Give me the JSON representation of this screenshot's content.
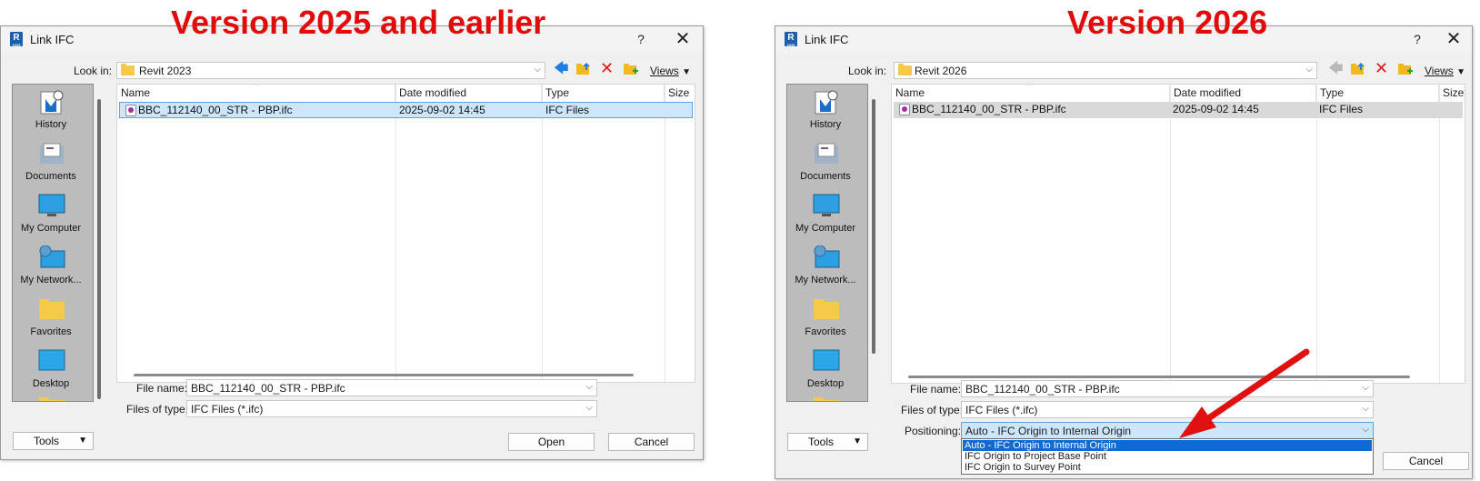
{
  "headings": {
    "left": "Version 2025 and earlier",
    "right": "Version 2026"
  },
  "colors": {
    "heading": "#e20a0a",
    "selection_blue": "#cde6fb",
    "dropdown_highlight": "#0f6ad6",
    "arrow": "#e01010"
  },
  "left_dialog": {
    "title": "Link IFC",
    "help": "?",
    "close": "✕",
    "look_in_label": "Look in:",
    "look_in_value": "Revit 2023",
    "views_label": "Views",
    "sidebar": [
      {
        "label": "History",
        "icon": "history-icon"
      },
      {
        "label": "Documents",
        "icon": "documents-icon"
      },
      {
        "label": "My Computer",
        "icon": "computer-icon"
      },
      {
        "label": "My Network...",
        "icon": "network-icon"
      },
      {
        "label": "Favorites",
        "icon": "favorites-folder-icon"
      },
      {
        "label": "Desktop",
        "icon": "desktop-icon"
      }
    ],
    "columns": [
      "Name",
      "Date modified",
      "Type",
      "Size"
    ],
    "files": [
      {
        "name": "BBC_112140_00_STR - PBP.ifc",
        "date": "2025-09-02 14:45",
        "type": "IFC Files",
        "size": ""
      }
    ],
    "file_name_label": "File name:",
    "file_name_value": "BBC_112140_00_STR - PBP.ifc",
    "files_of_type_label": "Files of type:",
    "files_of_type_value": "IFC Files  (*.ifc)",
    "tools_label": "Tools",
    "open_label": "Open",
    "cancel_label": "Cancel"
  },
  "right_dialog": {
    "title": "Link IFC",
    "help": "?",
    "close": "✕",
    "look_in_label": "Look in:",
    "look_in_value": "Revit 2026",
    "views_label": "Views",
    "sidebar": [
      {
        "label": "History",
        "icon": "history-icon"
      },
      {
        "label": "Documents",
        "icon": "documents-icon"
      },
      {
        "label": "My Computer",
        "icon": "computer-icon"
      },
      {
        "label": "My Network...",
        "icon": "network-icon"
      },
      {
        "label": "Favorites",
        "icon": "favorites-folder-icon"
      },
      {
        "label": "Desktop",
        "icon": "desktop-icon"
      }
    ],
    "columns": [
      "Name",
      "Date modified",
      "Type",
      "Size"
    ],
    "files": [
      {
        "name": "BBC_112140_00_STR - PBP.ifc",
        "date": "2025-09-02 14:45",
        "type": "IFC Files",
        "size": ""
      }
    ],
    "file_name_label": "File name:",
    "file_name_value": "BBC_112140_00_STR - PBP.ifc",
    "files_of_type_label": "Files of type:",
    "files_of_type_value": "IFC Files (*.ifc)",
    "positioning_label": "Positioning:",
    "positioning_value": "Auto - IFC Origin to Internal Origin",
    "positioning_options": [
      "Auto - IFC Origin to Internal Origin",
      "IFC Origin to Project Base Point",
      "IFC Origin to Survey Point"
    ],
    "tools_label": "Tools",
    "cancel_label": "Cancel"
  }
}
